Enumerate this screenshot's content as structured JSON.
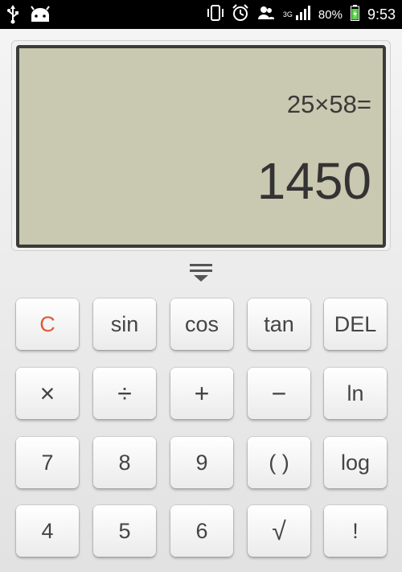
{
  "status_bar": {
    "battery_percent": "80%",
    "time": "9:53",
    "network": "3G"
  },
  "display": {
    "expression": "25×58=",
    "result": "1450"
  },
  "keypad": {
    "rows": [
      [
        {
          "label": "C",
          "name": "clear-key",
          "color": "#e05a3a"
        },
        {
          "label": "sin",
          "name": "sin-key"
        },
        {
          "label": "cos",
          "name": "cos-key"
        },
        {
          "label": "tan",
          "name": "tan-key"
        },
        {
          "label": "DEL",
          "name": "delete-key"
        }
      ],
      [
        {
          "label": "×",
          "name": "multiply-key"
        },
        {
          "label": "÷",
          "name": "divide-key"
        },
        {
          "label": "+",
          "name": "plus-key"
        },
        {
          "label": "−",
          "name": "minus-key"
        },
        {
          "label": "ln",
          "name": "ln-key"
        }
      ],
      [
        {
          "label": "7",
          "name": "digit-7-key"
        },
        {
          "label": "8",
          "name": "digit-8-key"
        },
        {
          "label": "9",
          "name": "digit-9-key"
        },
        {
          "label": "( )",
          "name": "parentheses-key"
        },
        {
          "label": "log",
          "name": "log-key"
        }
      ],
      [
        {
          "label": "4",
          "name": "digit-4-key"
        },
        {
          "label": "5",
          "name": "digit-5-key"
        },
        {
          "label": "6",
          "name": "digit-6-key"
        },
        {
          "label": "√",
          "name": "sqrt-key"
        },
        {
          "label": "!",
          "name": "factorial-key"
        }
      ]
    ]
  },
  "icons": {
    "status_left": [
      "usb-icon",
      "android-icon"
    ],
    "status_right": [
      "vibrate-icon",
      "alarm-icon",
      "contacts-icon",
      "signal-icon",
      "battery-icon"
    ],
    "handle": "expand-handle-icon"
  }
}
